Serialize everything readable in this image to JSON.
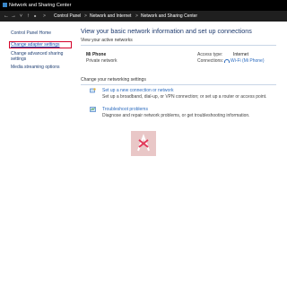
{
  "window": {
    "title": "Network and Sharing Center"
  },
  "address": {
    "crumbs": [
      "Control Panel",
      "Network and Internet",
      "Network and Sharing Center"
    ]
  },
  "left_pane": {
    "home": "Control Panel Home",
    "adapter": "Change adapter settings",
    "advanced": "Change advanced sharing settings",
    "media": "Media streaming options"
  },
  "main": {
    "heading": "View your basic network information and set up connections",
    "active_title": "View your active networks",
    "network_name": "Mi Phone",
    "network_type": "Private network",
    "access_label": "Access type:",
    "access_value": "Internet",
    "conn_label": "Connections:",
    "conn_value": "Wi-Fi (Mi Phone)",
    "change_title": "Change your networking settings",
    "item1_title": "Set up a new connection or network",
    "item1_desc": "Set up a broadband, dial-up, or VPN connection; or set up a router or access point.",
    "item2_title": "Troubleshoot problems",
    "item2_desc": "Diagnose and repair network problems, or get troubleshooting information."
  },
  "colors": {
    "accent": "#d4002a",
    "link": "#2b6bbf",
    "title_bg": "#000000",
    "heading": "#1e3a6e"
  },
  "icons": [
    "network-center-icon",
    "back-arrow-icon",
    "forward-arrow-icon",
    "up-arrow-icon",
    "wifi-icon",
    "new-connection-icon",
    "troubleshoot-icon"
  ]
}
